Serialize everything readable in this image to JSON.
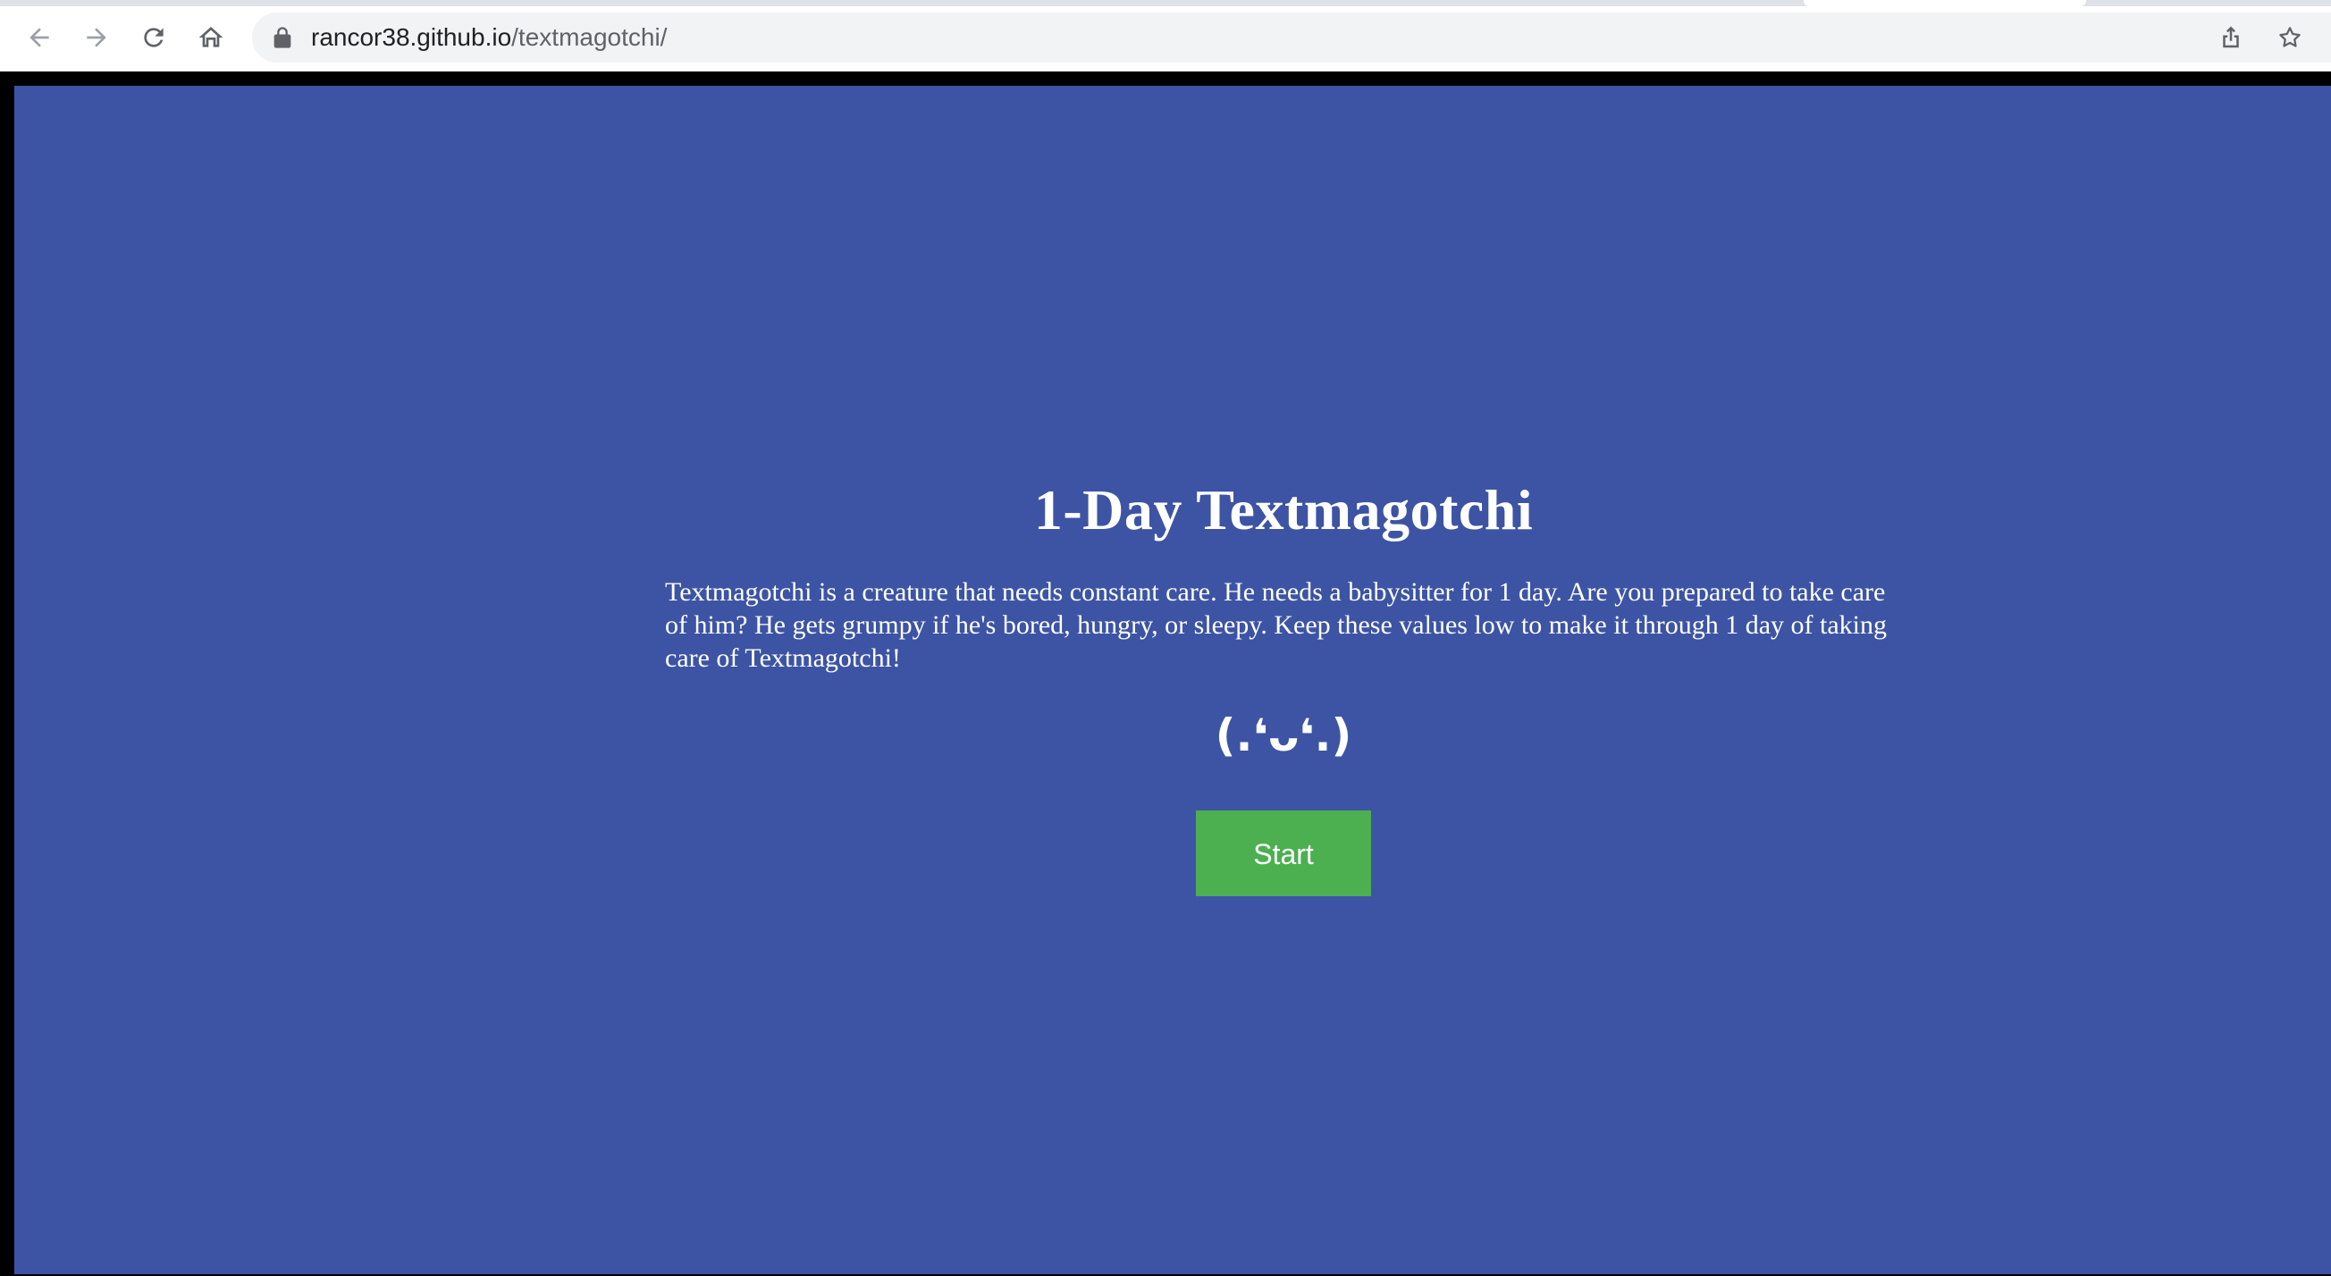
{
  "browser": {
    "url_host": "rancor38.github.io",
    "url_path": "/textmagotchi/",
    "icons": {
      "back": "arrow-left-icon",
      "forward": "arrow-right-icon",
      "reload": "reload-icon",
      "home": "home-icon",
      "lock": "lock-icon",
      "share": "share-icon",
      "bookmark": "star-icon"
    }
  },
  "page": {
    "title": "1-Day Textmagotchi",
    "description": "Textmagotchi is a creature that needs constant care. He needs a babysitter for 1 day. Are you prepared to take care of him? He gets grumpy if he's bored, hungry, or sleepy. Keep these values low to make it through 1 day of taking care of Textmagotchi!",
    "creature": "(.❛ᴗ❛.)",
    "start_label": "Start"
  },
  "colors": {
    "background": "#3d54a4",
    "button": "#4caf50",
    "text": "#ffffff"
  }
}
